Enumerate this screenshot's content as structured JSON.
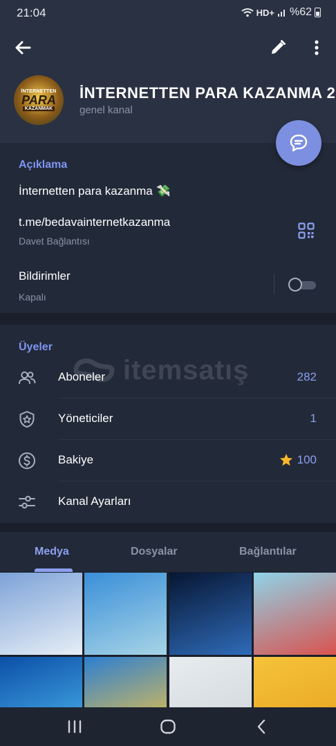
{
  "status_bar": {
    "time": "21:04",
    "network": "HD+",
    "battery": "%62"
  },
  "header": {
    "back_icon": "back-arrow-icon",
    "edit_icon": "pencil-icon",
    "menu_icon": "more-vertical-icon",
    "avatar": {
      "top_text": "İNTERNETTEN",
      "main_text": "PARA",
      "bottom_text": "KAZANMAK"
    },
    "title": "İNTERNETTEN PARA KAZANMA 2",
    "subtitle": "genel kanal",
    "fab_icon": "chat-bubble-icon"
  },
  "info": {
    "section_title": "Açıklama",
    "description": "İnternetten para kazanma 💸",
    "link": "t.me/bedavainternetkazanma",
    "link_caption": "Davet Bağlantısı",
    "qr_icon": "qr-code-icon",
    "notifications_label": "Bildirimler",
    "notifications_state": "Kapalı",
    "notifications_on": false
  },
  "members": {
    "section_title": "Üyeler",
    "rows": [
      {
        "icon": "people-icon",
        "label": "Aboneler",
        "value": "282"
      },
      {
        "icon": "admin-shield-icon",
        "label": "Yöneticiler",
        "value": "1"
      },
      {
        "icon": "dollar-coin-icon",
        "label": "Bakiye",
        "value": "100",
        "value_icon": "star-icon"
      },
      {
        "icon": "settings-sliders-icon",
        "label": "Kanal Ayarları",
        "value": ""
      }
    ]
  },
  "watermark": {
    "text": "itemsatış"
  },
  "tabs": [
    {
      "label": "Medya",
      "active": true
    },
    {
      "label": "Dosyalar",
      "active": false
    },
    {
      "label": "Bağlantılar",
      "active": false
    }
  ],
  "media_thumbnails": [
    {
      "colors": [
        "#7da3d8",
        "#e7eef6"
      ]
    },
    {
      "colors": [
        "#3a8fd9",
        "#a7d4e6"
      ]
    },
    {
      "colors": [
        "#071633",
        "#2f6bb8"
      ]
    },
    {
      "colors": [
        "#8fd3e8",
        "#d9534f"
      ]
    },
    {
      "colors": [
        "#0c4fa8",
        "#4ab3ea"
      ]
    },
    {
      "colors": [
        "#2d7fd1",
        "#f4c542"
      ]
    },
    {
      "colors": [
        "#e8ecef",
        "#cfd5da"
      ]
    },
    {
      "colors": [
        "#f5c33b",
        "#e8a21f"
      ]
    }
  ],
  "nav_bar": {
    "recents_icon": "recents-icon",
    "home_icon": "home-icon",
    "back_icon": "nav-back-icon"
  },
  "colors": {
    "accent": "#8da0f0",
    "background": "#1a1f2b",
    "panel": "#222938",
    "header": "#2a3142"
  }
}
